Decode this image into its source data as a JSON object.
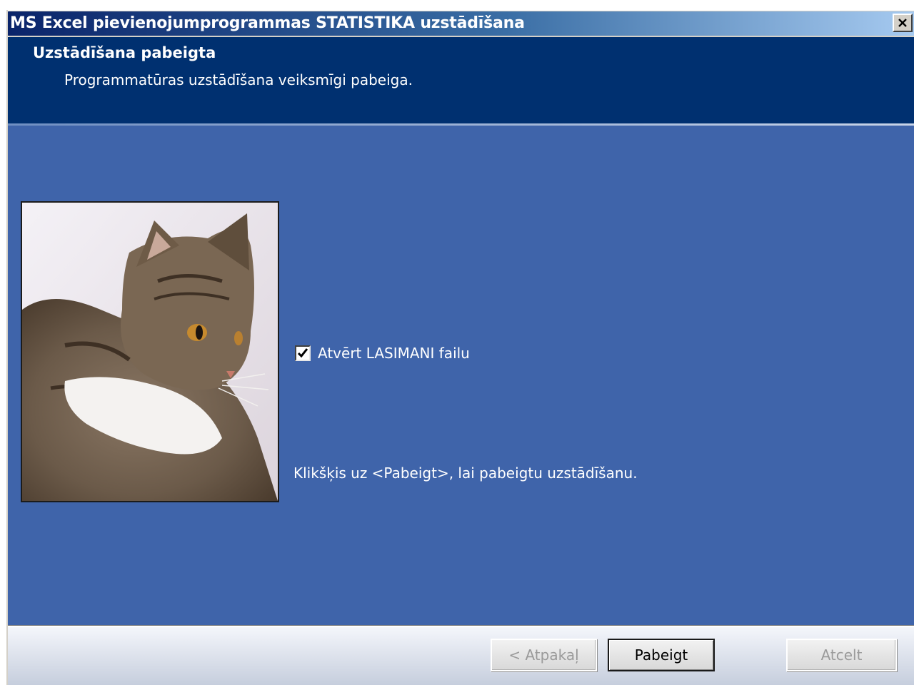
{
  "window": {
    "title": "MS Excel pievienojumprogrammas STATISTIKA uzstādīšana",
    "close_glyph": "×"
  },
  "header": {
    "title": "Uzstādīšana pabeigta",
    "subtitle": "Programmatūras uzstādīšana veiksmīgi pabeiga."
  },
  "main": {
    "picture_icon": "cat-photo",
    "checkbox": {
      "label": "Atvērt LASIMANI failu",
      "checked": true
    },
    "instruction": "Klikšķis uz <Pabeigt>, lai pabeigtu uzstādīšanu."
  },
  "buttons": {
    "back_label": "< Atpakaļ",
    "finish_label": "Pabeigt",
    "cancel_label": "Atcelt"
  },
  "colors": {
    "header_bg": "#003070",
    "body_bg": "#3f64aa",
    "title_gradient_start": "#0a246a",
    "title_gradient_end": "#a6caf0"
  }
}
